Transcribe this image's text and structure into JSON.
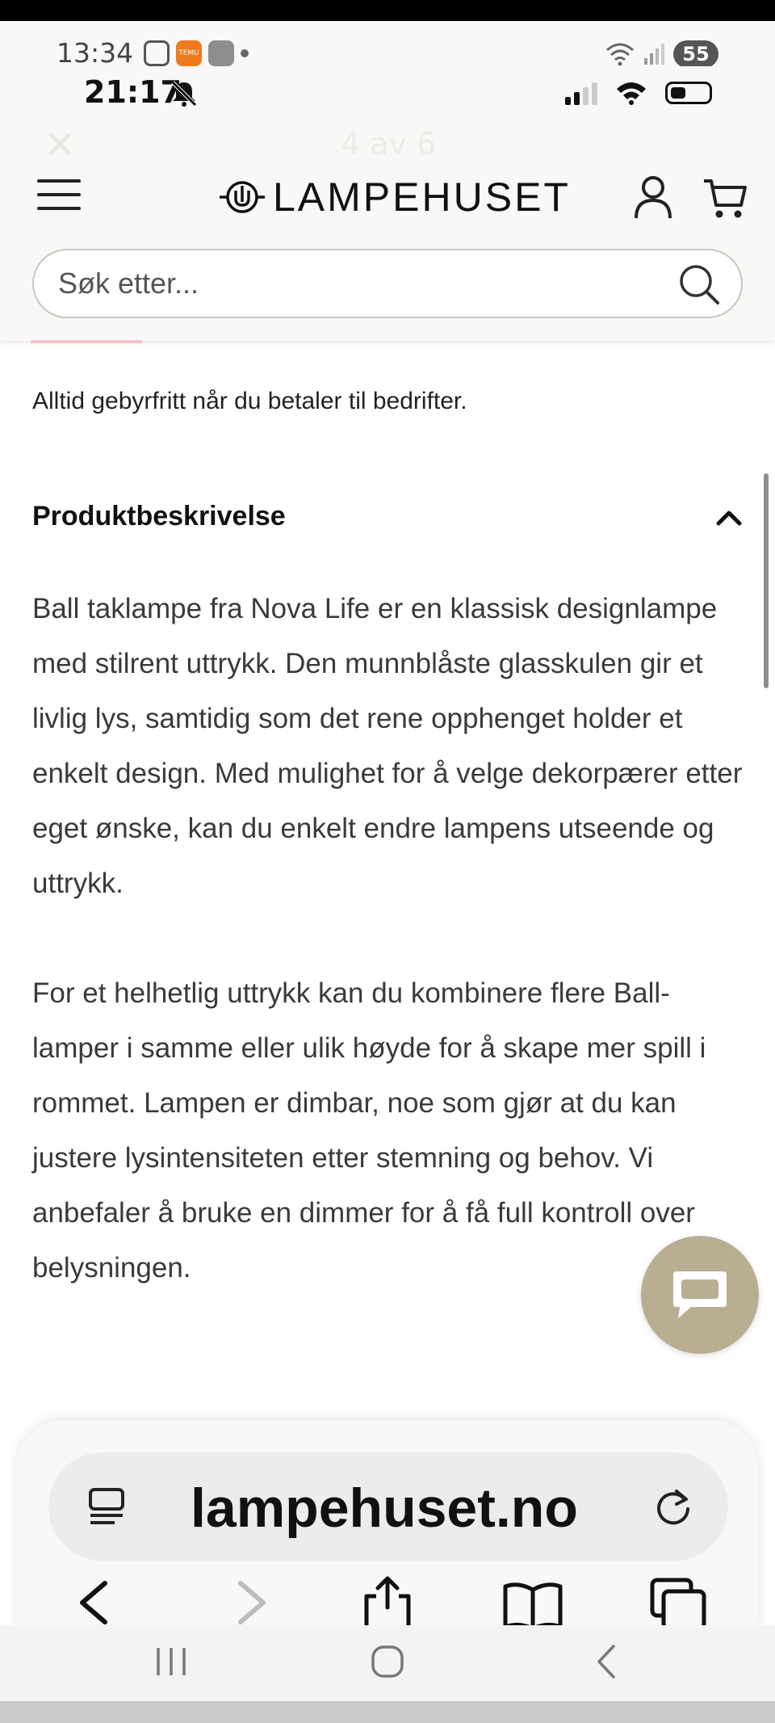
{
  "android_status": {
    "time": "13:34",
    "battery_percent": "55",
    "temu_label": "TEMU"
  },
  "ios_status": {
    "time": "21:17"
  },
  "gallery": {
    "counter": "4 av 6"
  },
  "header": {
    "logo_text": "LAMPEHUSET",
    "search_placeholder": "Søk etter..."
  },
  "content": {
    "payment_note": "Alltid gebyrfritt når du betaler til bedrifter.",
    "section_title": "Produktbeskrivelse",
    "paragraphs": [
      "Ball taklampe fra Nova Life er en klassisk designlampe med stilrent uttrykk. Den munnblåste glasskulen gir et livlig lys, samtidig som det rene opphenget holder et enkelt design. Med mulighet for å velge dekorpærer etter eget ønske, kan du enkelt endre lampens utseende og uttrykk.",
      "For et helhetlig uttrykk kan du kombinere flere Ball-lamper i samme eller ulik høyde for å skape mer spill i rommet. Lampen er dimbar, noe som gjør at du kan justere lysintensiteten etter stemning og behov. Vi anbefaler å bruke en dimmer for å få full kontroll over belysningen."
    ]
  },
  "browser": {
    "url": "lampehuset.no"
  },
  "icons": {
    "menu": "hamburger-menu-icon",
    "user": "user-icon",
    "cart": "cart-icon",
    "search": "search-icon",
    "chevron": "chevron-up-icon",
    "chat": "chat-icon",
    "reader": "reader-icon",
    "reload": "reload-icon"
  },
  "colors": {
    "header_bg": "#f9f8f6",
    "chat_bubble": "#b9ae92",
    "text": "#3a3a3a"
  }
}
